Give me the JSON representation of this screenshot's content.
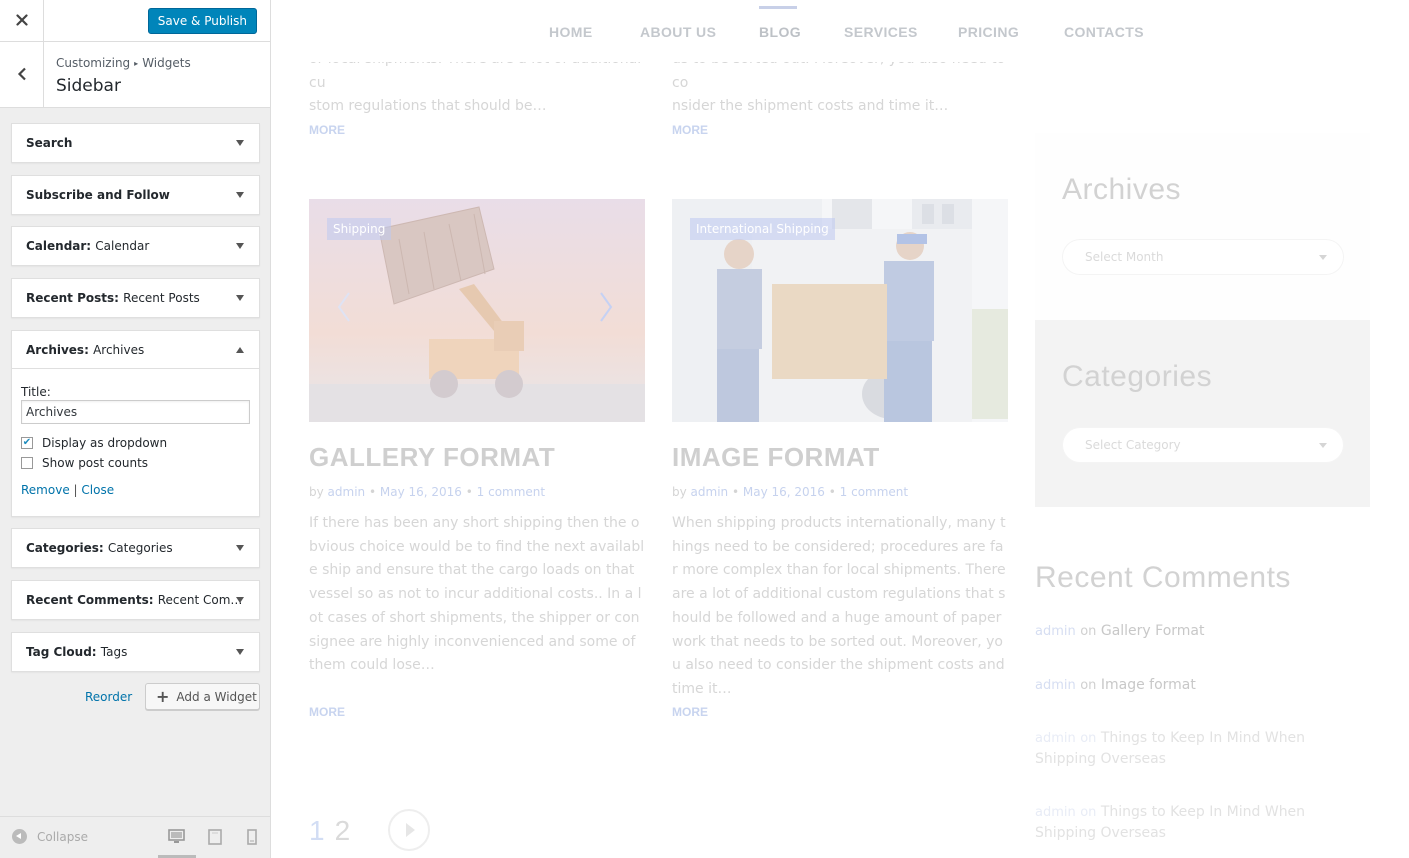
{
  "customizer": {
    "publish_label": "Save & Publish",
    "breadcrumb": [
      "Customizing",
      "Widgets"
    ],
    "breadcrumb_sep": "▸",
    "section_title": "Sidebar",
    "widgets": [
      {
        "name": "Search",
        "subtitle": ""
      },
      {
        "name": "Subscribe and Follow",
        "subtitle": ""
      },
      {
        "name": "Calendar:",
        "subtitle": "Calendar"
      },
      {
        "name": "Recent Posts:",
        "subtitle": "Recent Posts"
      },
      {
        "name": "Archives:",
        "subtitle": "Archives"
      },
      {
        "name": "Categories:",
        "subtitle": "Categories"
      },
      {
        "name": "Recent Comments:",
        "subtitle": "Recent Com…"
      },
      {
        "name": "Tag Cloud:",
        "subtitle": "Tags"
      }
    ],
    "archives_form": {
      "title_label": "Title:",
      "title_value": "Archives",
      "dropdown_label": "Display as dropdown",
      "dropdown_checked": true,
      "counts_label": "Show post counts",
      "counts_checked": false,
      "remove_label": "Remove",
      "separator": "|",
      "close_label": "Close"
    },
    "reorder_label": "Reorder",
    "add_widget_label": "Add a Widget",
    "collapse_label": "Collapse",
    "accent_color": "#0085ba"
  },
  "preview": {
    "nav": [
      "HOME",
      "ABOUT US",
      "BLOG",
      "SERVICES",
      "PRICING",
      "CONTACTS"
    ],
    "nav_active": "BLOG",
    "top_excerpts": [
      {
        "line1": "or local shipments. There are a lot of additional cu",
        "line2": "stom regulations that should be…"
      },
      {
        "line1": "ds to be sorted out. Moreover, you also need to co",
        "line2": "nsider the shipment costs and time it…"
      }
    ],
    "more_label": "MORE",
    "posts": [
      {
        "category": "Shipping",
        "title": "GALLERY FORMAT",
        "by": "by",
        "author": "admin",
        "date": "May 16, 2016",
        "comments": "1 comment",
        "excerpt": "If there has been any short shipping then the obvious choice would be to find the next available ship and ensure that the cargo loads on that vessel so as not to incur additional costs.. In a lot cases of short shipments, the shipper or consignee are highly inconvenienced and some of them could lose…"
      },
      {
        "category": "International Shipping",
        "title": "IMAGE FORMAT",
        "by": "by",
        "author": "admin",
        "date": "May 16, 2016",
        "comments": "1 comment",
        "excerpt": "When shipping products internationally, many things need to be considered; procedures are far more complex than for local shipments. There are a lot of additional custom regulations that should be followed and a huge amount of paperwork that needs to be sorted out. Moreover, you also need to consider the shipment costs and time it…"
      }
    ],
    "sidebar": {
      "archives_title": "Archives",
      "archives_select": "Select Month",
      "categories_title": "Categories",
      "categories_select": "Select Category",
      "recent_comments_title": "Recent Comments",
      "comments": [
        {
          "author": "admin",
          "on": "on",
          "post": "Gallery Format"
        },
        {
          "author": "admin",
          "on": "on",
          "post": "Image format"
        },
        {
          "author": "admin",
          "on": "on",
          "post": "Things to Keep In Mind When Shipping Overseas"
        },
        {
          "author": "admin",
          "on": "on",
          "post": "Things to Keep In Mind When Shipping Overseas"
        }
      ]
    },
    "pagination": [
      "1",
      "2"
    ]
  }
}
